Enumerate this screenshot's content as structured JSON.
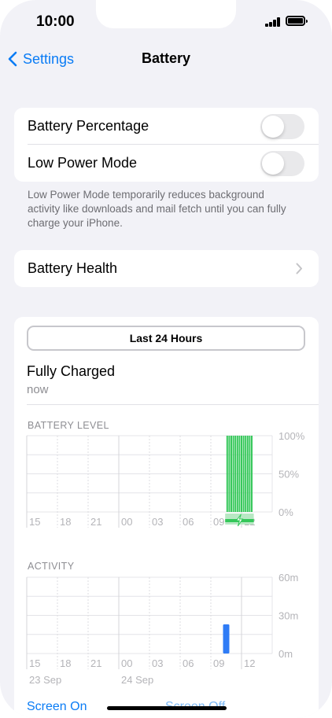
{
  "status_bar": {
    "time": "10:00"
  },
  "nav": {
    "back_label": "Settings",
    "title": "Battery"
  },
  "settings": {
    "battery_percentage_label": "Battery Percentage",
    "battery_percentage_on": false,
    "low_power_mode_label": "Low Power Mode",
    "low_power_mode_on": false,
    "low_power_footnote": "Low Power Mode temporarily reduces background activity like downloads and mail fetch until you can fully charge your iPhone.",
    "battery_health_label": "Battery Health"
  },
  "usage": {
    "range_label": "Last 24 Hours",
    "charge_status": "Fully Charged",
    "charge_time": "now"
  },
  "colors": {
    "accent": "#0a7cf5",
    "battery_green": "#34c759",
    "activity_blue": "#2f7cf6"
  },
  "chart_data": [
    {
      "type": "bar",
      "title": "BATTERY LEVEL",
      "x_ticks": [
        "15",
        "18",
        "21",
        "00",
        "03",
        "06",
        "09",
        "12"
      ],
      "y_ticks": [
        "100%",
        "50%",
        "0%"
      ],
      "ylim": [
        0,
        100
      ],
      "grid": true,
      "hours_from_15": [
        19.6,
        19.8,
        20.0,
        20.2,
        20.4,
        20.6,
        20.8,
        21.0,
        21.2,
        21.4,
        21.6,
        21.8,
        22.0
      ],
      "values": [
        100,
        100,
        100,
        100,
        100,
        100,
        100,
        100,
        100,
        100,
        100,
        100,
        100
      ],
      "charging_from_hour": 19.4,
      "charging_to_hour": 22.2
    },
    {
      "type": "bar",
      "title": "ACTIVITY",
      "x_ticks": [
        "15",
        "18",
        "21",
        "00",
        "03",
        "06",
        "09",
        "12"
      ],
      "date_labels": [
        "23 Sep",
        "24 Sep"
      ],
      "y_ticks": [
        "60m",
        "30m",
        "0m"
      ],
      "ylim": [
        0,
        60
      ],
      "grid": true,
      "hours_from_15": [
        19.5
      ],
      "values": [
        23
      ],
      "legend": [
        "Screen On",
        "Screen Off"
      ]
    }
  ]
}
